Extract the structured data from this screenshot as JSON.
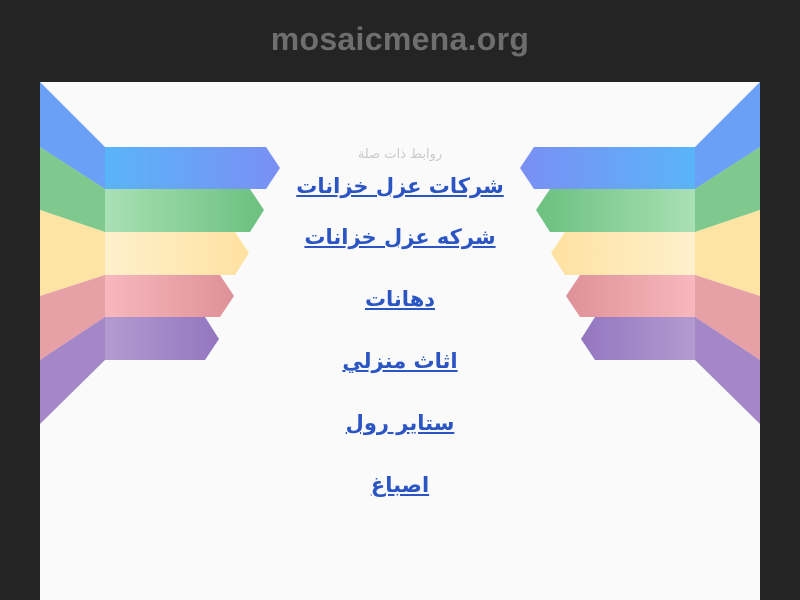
{
  "site": {
    "domain": "mosaicmena.org"
  },
  "related": {
    "label": "روابط ذات صلة",
    "links": [
      "شركات عزل خزانات",
      "شركه عزل خزانات",
      "دهانات",
      "اثاث منزلي",
      "ستاير رول",
      "اصباغ"
    ]
  },
  "theme": {
    "background": "#242424",
    "panel": "#fafafa",
    "title": "#6e6e6e",
    "link": "#2b55c3",
    "ribbons": [
      "#6f93f5",
      "#7cc98a",
      "#fde4a8",
      "#eaa1a6",
      "#9b7ec2"
    ]
  }
}
